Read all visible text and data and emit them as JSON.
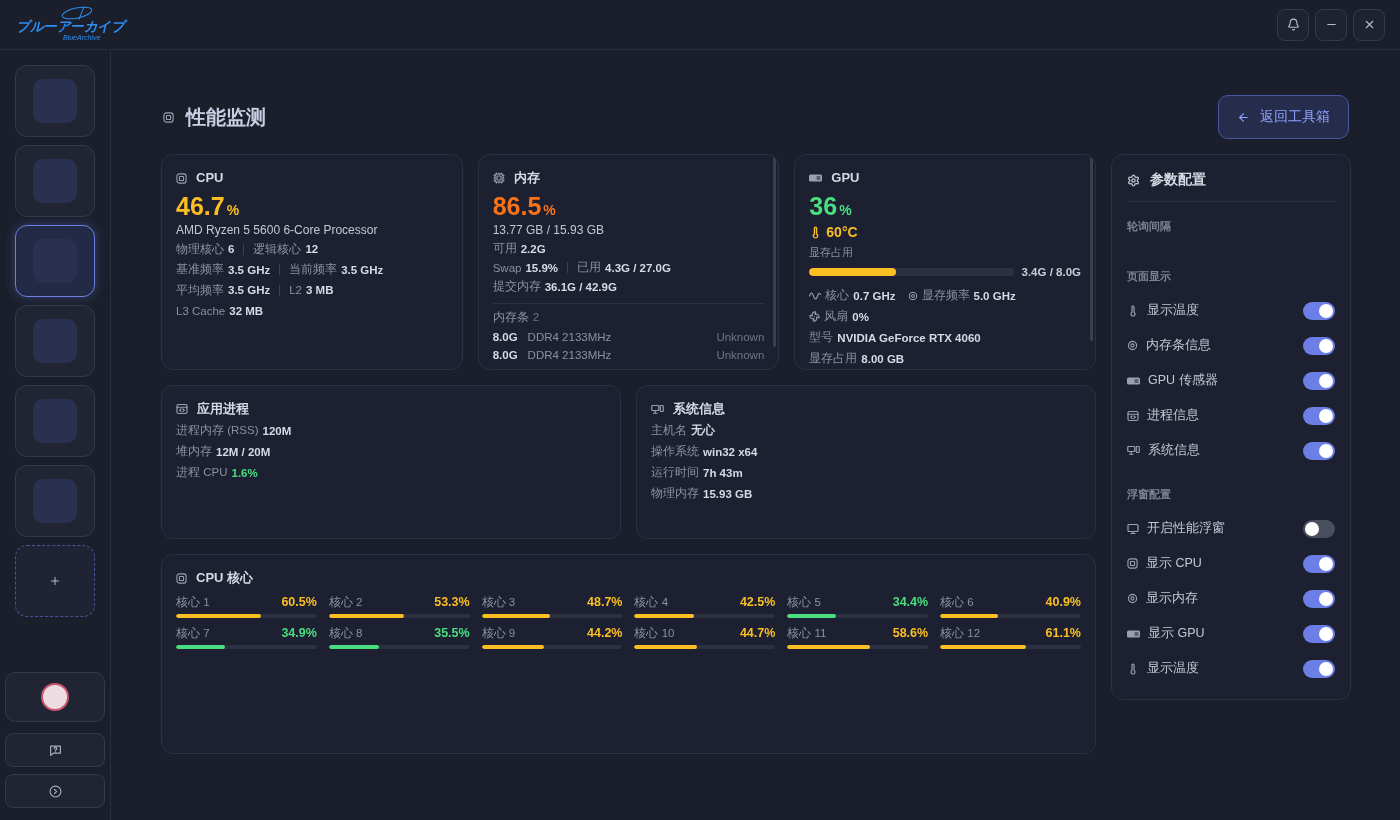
{
  "logo": {
    "title": "ブルーアーカイブ",
    "subtitle": "BlueArchive"
  },
  "sidebar": {
    "items": [
      {
        "selected": false
      },
      {
        "selected": false
      },
      {
        "selected": true
      },
      {
        "selected": false
      },
      {
        "selected": false
      },
      {
        "selected": false
      }
    ]
  },
  "page": {
    "title": "性能监测",
    "back_button": "返回工具箱"
  },
  "cpu": {
    "title": "CPU",
    "usage": "46.7",
    "unit": "%",
    "model": "AMD Ryzen 5 5600 6-Core Processor",
    "stats": [
      [
        {
          "label": "物理核心",
          "value": "6"
        },
        {
          "label": "逻辑核心",
          "value": "12"
        }
      ],
      [
        {
          "label": "基准频率",
          "value": "3.5 GHz"
        },
        {
          "label": "当前频率",
          "value": "3.5 GHz"
        }
      ],
      [
        {
          "label": "平均频率",
          "value": "3.5 GHz"
        },
        {
          "label": "L2",
          "value": "3 MB"
        }
      ],
      [
        {
          "label": "L3 Cache",
          "value": "32 MB"
        }
      ]
    ]
  },
  "memory": {
    "title": "内存",
    "usage": "86.5",
    "unit": "%",
    "amount": "13.77 GB / 15.93 GB",
    "stats": [
      [
        {
          "label": "可用",
          "value": "2.2G"
        }
      ],
      [
        {
          "label": "Swap",
          "value": "15.9%"
        },
        {
          "label": "已用",
          "value": "4.3G / 27.0G"
        }
      ],
      [
        {
          "label": "提交内存",
          "value": "36.1G / 42.9G"
        }
      ]
    ],
    "modules_label": "内存条",
    "modules_count": "2",
    "modules": [
      {
        "size": "8.0G",
        "type": "DDR4 2133MHz",
        "vendor": "Unknown"
      },
      {
        "size": "8.0G",
        "type": "DDR4 2133MHz",
        "vendor": "Unknown"
      }
    ]
  },
  "gpu": {
    "title": "GPU",
    "usage": "36",
    "unit": "%",
    "temperature": "60°C",
    "vram_label": "显存占用",
    "vram": {
      "level": 0.425,
      "reading": "3.4G / 8.0G"
    },
    "stats": [
      [
        {
          "kind": "clock",
          "label": "核心",
          "value": "0.7 GHz"
        },
        {
          "kind": "memory_clock",
          "label": "显存频率",
          "value": "5.0 GHz"
        }
      ],
      [
        {
          "kind": "fan",
          "label": "风扇",
          "value": "0%"
        }
      ],
      [
        {
          "kind": "plain",
          "label": "型号",
          "value": "NVIDIA GeForce RTX 4060"
        }
      ],
      [
        {
          "kind": "plain",
          "label": "显存占用",
          "value": "8.00 GB"
        }
      ]
    ]
  },
  "processes": {
    "title": "应用进程",
    "rows": [
      {
        "label": "进程内存 (RSS)",
        "value": "120M",
        "color": "#d6dae3"
      },
      {
        "label": "堆内存",
        "value": "12M / 20M",
        "color": "#d6dae3"
      },
      {
        "label": "进程 CPU",
        "value": "1.6%",
        "color": "#4ade80"
      }
    ]
  },
  "system": {
    "title": "系统信息",
    "rows": [
      {
        "label": "主机名",
        "value": "无心"
      },
      {
        "label": "操作系统",
        "value": "win32 x64"
      },
      {
        "label": "运行时间",
        "value": "7h 43m"
      },
      {
        "label": "物理内存",
        "value": "15.93 GB"
      }
    ]
  },
  "cores": {
    "title": "CPU 核心",
    "items": [
      {
        "label": "核心 1",
        "reading": "60.5%",
        "level": 0.605,
        "color": "#fbbf24"
      },
      {
        "label": "核心 2",
        "reading": "53.3%",
        "level": 0.533,
        "color": "#fbbf24"
      },
      {
        "label": "核心 3",
        "reading": "48.7%",
        "level": 0.487,
        "color": "#fbbf24"
      },
      {
        "label": "核心 4",
        "reading": "42.5%",
        "level": 0.425,
        "color": "#fbbf24"
      },
      {
        "label": "核心 5",
        "reading": "34.4%",
        "level": 0.344,
        "color": "#4ade80"
      },
      {
        "label": "核心 6",
        "reading": "40.9%",
        "level": 0.409,
        "color": "#fbbf24"
      },
      {
        "label": "核心 7",
        "reading": "34.9%",
        "level": 0.349,
        "color": "#4ade80"
      },
      {
        "label": "核心 8",
        "reading": "35.5%",
        "level": 0.355,
        "color": "#4ade80"
      },
      {
        "label": "核心 9",
        "reading": "44.2%",
        "level": 0.442,
        "color": "#fbbf24"
      },
      {
        "label": "核心 10",
        "reading": "44.7%",
        "level": 0.447,
        "color": "#fbbf24"
      },
      {
        "label": "核心 11",
        "reading": "58.6%",
        "level": 0.586,
        "color": "#fbbf24"
      },
      {
        "label": "核心 12",
        "reading": "61.1%",
        "level": 0.611,
        "color": "#fbbf24"
      }
    ]
  },
  "settings": {
    "title": "参数配置",
    "sections": [
      {
        "title": "轮询间隔"
      },
      {
        "title": "页面显示",
        "items": [
          {
            "kind": "temperature",
            "label": "显示温度",
            "on": true
          },
          {
            "kind": "memory",
            "label": "内存条信息",
            "on": true
          },
          {
            "kind": "gpu",
            "label": "GPU 传感器",
            "on": true
          },
          {
            "kind": "process",
            "label": "进程信息",
            "on": true
          },
          {
            "kind": "system",
            "label": "系统信息",
            "on": true
          }
        ]
      },
      {
        "title": "浮窗配置",
        "items": [
          {
            "kind": "window",
            "label": "开启性能浮窗",
            "on": false
          },
          {
            "kind": "cpu",
            "label": "显示 CPU",
            "on": true
          },
          {
            "kind": "memory",
            "label": "显示内存",
            "on": true
          },
          {
            "kind": "gpu",
            "label": "显示 GPU",
            "on": true
          },
          {
            "kind": "temperature",
            "label": "显示温度",
            "on": true
          }
        ]
      }
    ]
  }
}
